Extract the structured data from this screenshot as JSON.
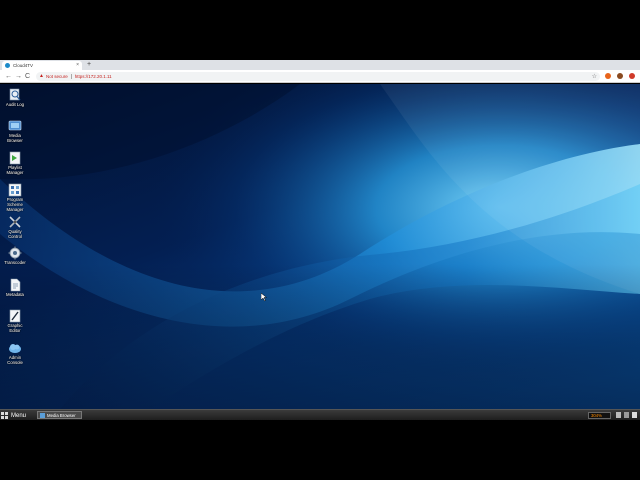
{
  "browser": {
    "tab_title": "Cloud4TV",
    "tab_close": "×",
    "new_tab": "+",
    "security_label": "Not secure",
    "url": "https://172.20.1.11",
    "nav_back": "←",
    "nav_forward": "→",
    "nav_reload": "C"
  },
  "desktop": {
    "icons": [
      {
        "label": "Audit Log",
        "icon": "audit-log-icon"
      },
      {
        "label": "Media Browser",
        "icon": "media-browser-icon"
      },
      {
        "label": "Playlist Manager",
        "icon": "playlist-manager-icon"
      },
      {
        "label": "Program Scheme Manager",
        "icon": "program-scheme-manager-icon"
      },
      {
        "label": "Quality Control",
        "icon": "quality-control-icon"
      },
      {
        "label": "Transcoder",
        "icon": "transcoder-icon"
      },
      {
        "label": "Metadata",
        "icon": "metadata-icon"
      },
      {
        "label": "Graphic Editor",
        "icon": "graphic-editor-icon"
      },
      {
        "label": "Admin Console",
        "icon": "admin-console-icon"
      }
    ]
  },
  "taskbar": {
    "menu_label": "Menu",
    "open_window": "Media Browser",
    "tray_meter": "304%"
  }
}
